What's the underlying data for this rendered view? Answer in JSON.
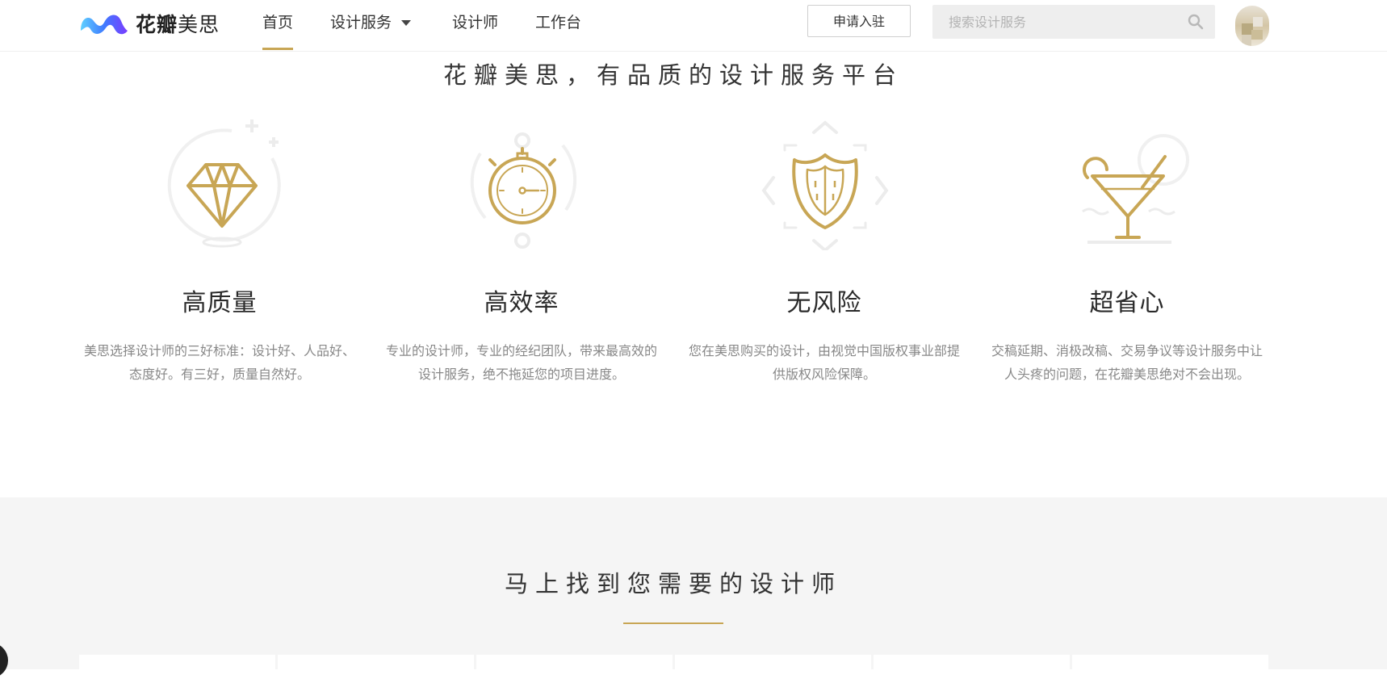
{
  "header": {
    "logo": {
      "brand_bold": "花瓣",
      "brand_light": "美思"
    },
    "nav": [
      {
        "label": "首页",
        "active": true
      },
      {
        "label": "设计服务",
        "has_dropdown": true
      },
      {
        "label": "设计师"
      },
      {
        "label": "工作台"
      }
    ],
    "apply_button": "申请入驻",
    "search": {
      "placeholder": "搜索设计服务",
      "icon": "search-icon"
    },
    "avatar": "user-avatar"
  },
  "features_section": {
    "title": "花瓣美思，有品质的设计服务平台",
    "accent_color": "#c8a655",
    "items": [
      {
        "icon": "diamond-icon",
        "title": "高质量",
        "desc": "美思选择设计师的三好标准：设计好、人品好、态度好。有三好，质量自然好。"
      },
      {
        "icon": "stopwatch-icon",
        "title": "高效率",
        "desc": "专业的设计师，专业的经纪团队，带来最高效的设计服务，绝不拖延您的项目进度。"
      },
      {
        "icon": "shield-icon",
        "title": "无风险",
        "desc": "您在美思购买的设计，由视觉中国版权事业部提供版权风险保障。"
      },
      {
        "icon": "cocktail-icon",
        "title": "超省心",
        "desc": "交稿延期、消极改稿、交易争议等设计服务中让人头疼的问题，在花瓣美思绝对不会出现。"
      }
    ]
  },
  "designers_section": {
    "title": "马上找到您需要的设计师"
  }
}
